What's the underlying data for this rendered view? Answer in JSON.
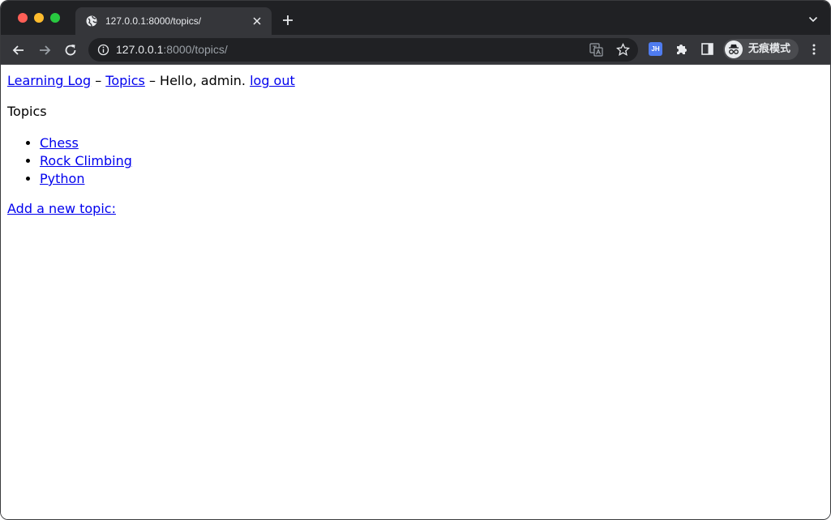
{
  "browser": {
    "tab": {
      "title": "127.0.0.1:8000/topics/"
    },
    "omnibox": {
      "url_host": "127.0.0.1",
      "url_path": ":8000/topics/"
    },
    "extension": {
      "label": "JH"
    },
    "profile": {
      "label": "无痕模式"
    }
  },
  "page": {
    "nav": {
      "home_link": "Learning Log",
      "separator1": " – ",
      "topics_link": "Topics",
      "separator2": " – ",
      "greeting": "Hello, admin. ",
      "logout_link": "log out"
    },
    "heading": "Topics",
    "topics": [
      {
        "name": "Chess"
      },
      {
        "name": "Rock Climbing"
      },
      {
        "name": "Python"
      }
    ],
    "add_topic_link": "Add a new topic:"
  },
  "colors": {
    "tabstrip": "#202124",
    "toolbar": "#35363a",
    "link": "#0000ee"
  }
}
